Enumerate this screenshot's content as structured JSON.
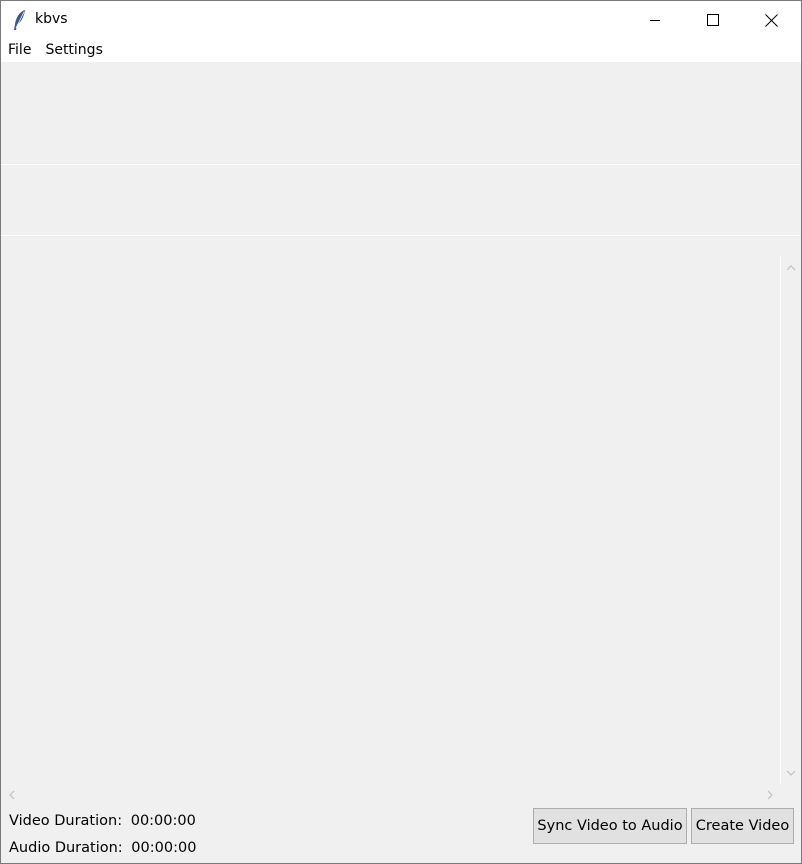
{
  "window": {
    "title": "kbvs",
    "app_icon": "feather-icon",
    "controls": [
      "minimize-icon",
      "maximize-icon",
      "close-icon"
    ]
  },
  "menu": {
    "items": [
      {
        "label": "File"
      },
      {
        "label": "Settings"
      }
    ]
  },
  "status": {
    "video_label": "Video Duration:",
    "video_value": "00:00:00",
    "audio_label": "Audio Duration:",
    "audio_value": "00:00:00"
  },
  "actions": {
    "sync_label": "Sync Video to Audio",
    "create_label": "Create Video"
  },
  "colors": {
    "window_bg": "#f0f0f0",
    "titlebar_bg": "#ffffff",
    "button_bg": "#e1e1e1",
    "button_border": "#adadad",
    "arrow": "#c8c8c8"
  }
}
